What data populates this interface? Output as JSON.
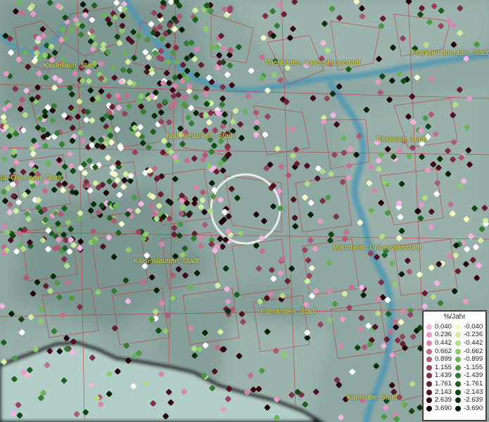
{
  "cities": [
    {
      "name": "Kastellaun, Stadt"
    },
    {
      "name": "Wiesbaden, Landeshauptstadt"
    },
    {
      "name": "Frankfurt am Main, Stadt"
    },
    {
      "name": "Bad Kreuznach, Stadt"
    },
    {
      "name": "Riedstadt, Stadt"
    },
    {
      "name": "Idar-Oberstein, Stadt"
    },
    {
      "name": "Mannheim, Universitätsstadt"
    },
    {
      "name": "Kaiserslautern, Stadt"
    },
    {
      "name": "Edenkoben, Stadt"
    },
    {
      "name": "Karlsruhe, Stadt"
    }
  ],
  "legend": {
    "title": "%/Jahr",
    "positive": [
      {
        "label": "0.040",
        "color": "#f2b6e0"
      },
      {
        "label": "0.236",
        "color": "#e59ac8"
      },
      {
        "label": "0.442",
        "color": "#d486ac"
      },
      {
        "label": "0.662",
        "color": "#c26f90"
      },
      {
        "label": "0.899",
        "color": "#ad5a76"
      },
      {
        "label": "1.155",
        "color": "#96445c"
      },
      {
        "label": "1.439",
        "color": "#7e3046"
      },
      {
        "label": "1.761",
        "color": "#661e31"
      },
      {
        "label": "2.143",
        "color": "#4f1020"
      },
      {
        "label": "2.639",
        "color": "#390714"
      },
      {
        "label": "3.690",
        "color": "#22020a"
      }
    ],
    "negative": [
      {
        "label": "-0.040",
        "color": "#f4f8c6"
      },
      {
        "label": "-0.236",
        "color": "#d4eca0"
      },
      {
        "label": "-0.442",
        "color": "#b3dc87"
      },
      {
        "label": "-0.662",
        "color": "#8fca70"
      },
      {
        "label": "-0.899",
        "color": "#6cb25a"
      },
      {
        "label": "-1.155",
        "color": "#4e9845"
      },
      {
        "label": "-1.439",
        "color": "#347c32"
      },
      {
        "label": "-1.761",
        "color": "#1f6022"
      },
      {
        "label": "-2.143",
        "color": "#124816"
      },
      {
        "label": "-2.639",
        "color": "#09330d"
      },
      {
        "label": "-3.690",
        "color": "#031f06"
      }
    ]
  },
  "colors": {
    "terrain": "#8fa7a3",
    "river": "#4d98b5",
    "boundaries": "#c23a3a",
    "label": "#e8e24a"
  }
}
